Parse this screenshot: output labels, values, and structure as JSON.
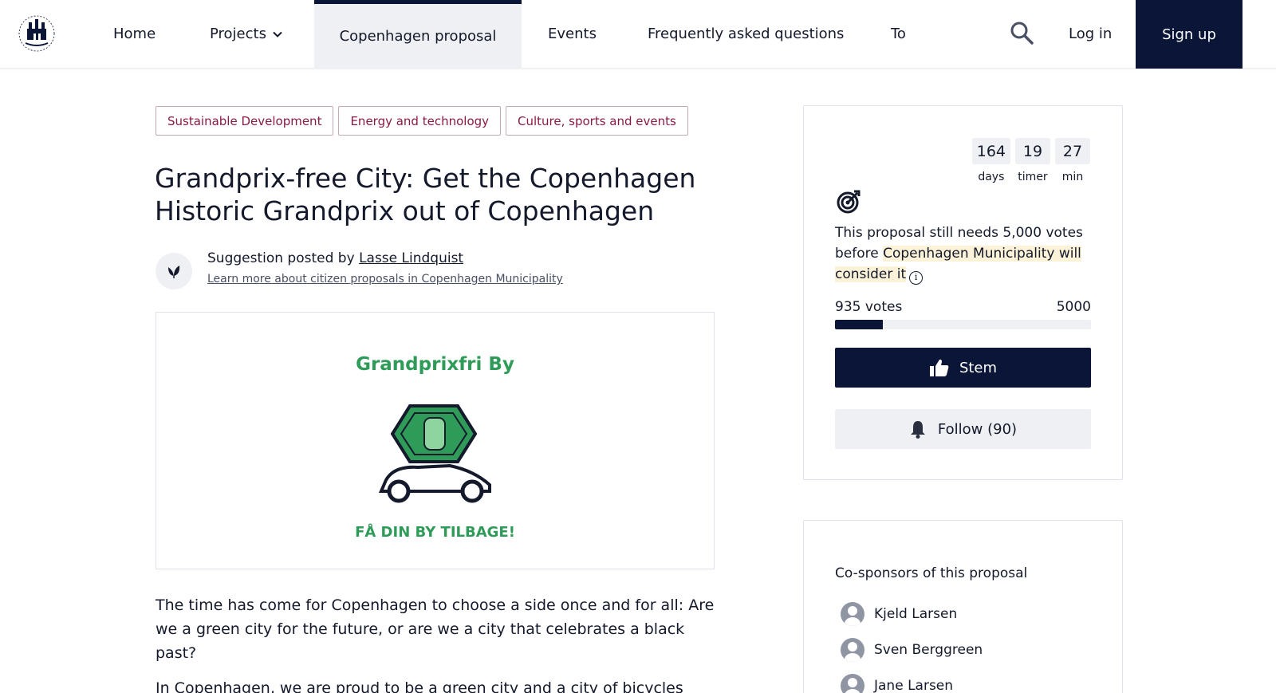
{
  "nav": {
    "items": [
      "Home",
      "Projects",
      "Copenhagen proposal",
      "Events",
      "Frequently asked questions",
      "To"
    ],
    "login": "Log in",
    "signup": "Sign up"
  },
  "tags": [
    "Sustainable Development",
    "Energy and technology",
    "Culture, sports and events"
  ],
  "proposal": {
    "title": "Grandprix-free City: Get the Copenhagen Historic Grandprix out of Copenhagen",
    "posted_prefix": "Suggestion posted by",
    "author": "Lasse Lindquist",
    "learn_more": "Learn more about citizen proposals in Copenhagen Municipality",
    "image_title": "Grandprixfri By",
    "image_bottom": "FÅ DIN BY TILBAGE!",
    "paragraphs": [
      "The time has come for Copenhagen to choose a side once and for all: Are we a green city for the future, or are we a city that celebrates a black past?",
      "In Copenhagen, we are proud to be a green city and a city of bicycles"
    ]
  },
  "sidebar": {
    "timer": [
      {
        "value": "164",
        "label": "days"
      },
      {
        "value": "19",
        "label": "timer"
      },
      {
        "value": "27",
        "label": "min"
      }
    ],
    "needs_prefix": "This proposal still needs 5,000 votes before",
    "needs_highlight": "Copenhagen Municipality will consider it",
    "votes_current": "935 votes",
    "votes_target": "5000",
    "progress_fraction": 0.187,
    "stem_label": "Stem",
    "follow_label": "Follow (90)"
  },
  "cosponsors": {
    "title": "Co-sponsors of this proposal",
    "names": [
      "Kjeld Larsen",
      "Sven Berggreen",
      "Jane Larsen"
    ]
  },
  "colors": {
    "navy": "#0a1538",
    "tag_text": "#8a1a45",
    "image_green": "#2e9c58",
    "highlight": "#fbf2d8"
  }
}
